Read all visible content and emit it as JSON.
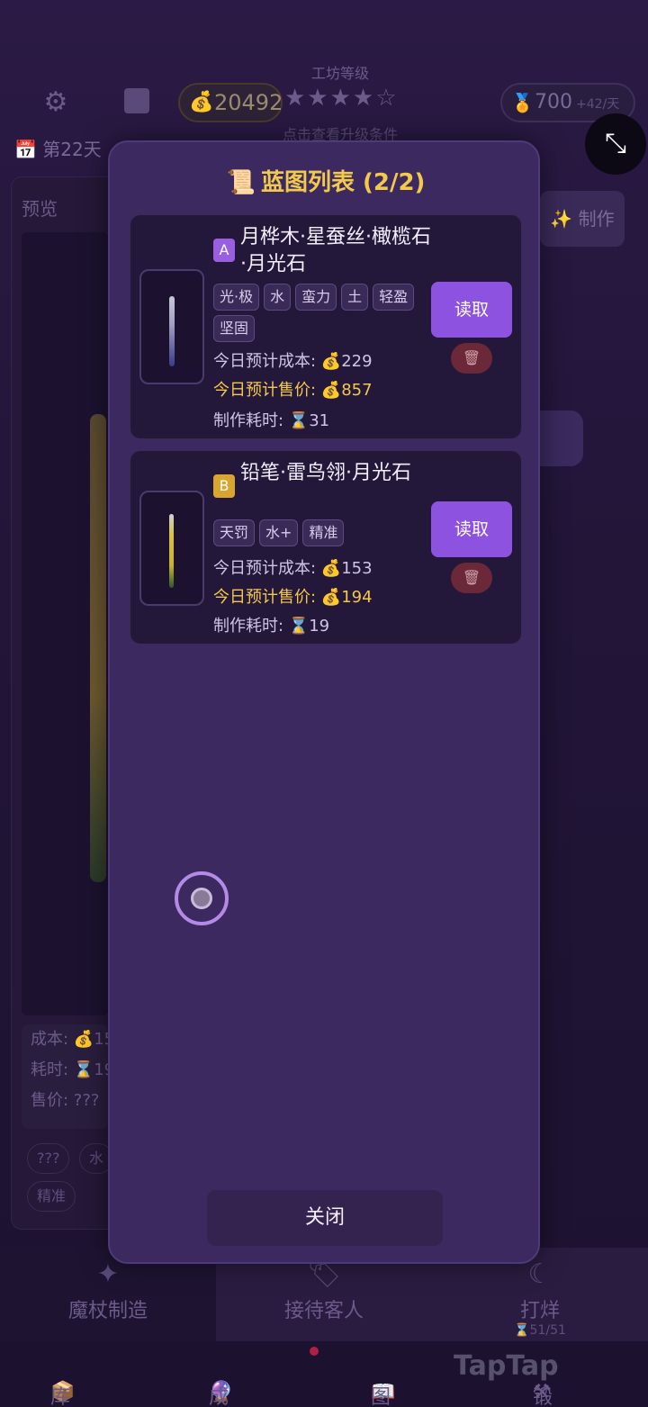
{
  "header": {
    "coins": "20492",
    "workshop_level_label": "工坊等级",
    "stars": "★★★★☆",
    "upgrade_hint": "点击查看升级条件",
    "medals": "700",
    "medal_rate": "+42/天",
    "day": "第22天"
  },
  "background": {
    "preview_label": "预览",
    "craft_label": "✨ 制作",
    "stats": [
      "成本: 💰15",
      "耗时: ⌛19",
      "售价: ???"
    ],
    "tags": [
      "???",
      "水",
      "精准"
    ]
  },
  "modal": {
    "title": "蓝图列表 (2/2)",
    "blueprints": [
      {
        "grade": "A",
        "name": "月桦木·星蚕丝·橄榄石·月光石",
        "tags": [
          "光·极",
          "水",
          "蛮力",
          "土",
          "轻盈",
          "坚固"
        ],
        "cost_label": "今日预计成本: 💰229",
        "price_label": "今日预计售价: 💰857",
        "time_label": "制作耗时: ⌛31",
        "read_label": "读取"
      },
      {
        "grade": "B",
        "name": "铅笔·雷鸟翎·月光石",
        "tags": [
          "天罚",
          "水+",
          "精准"
        ],
        "cost_label": "今日预计成本: 💰153",
        "price_label": "今日预计售价: 💰194",
        "time_label": "制作耗时: ⌛19",
        "read_label": "读取"
      }
    ],
    "close_label": "关闭"
  },
  "nav": {
    "tabs": [
      {
        "label": "魔杖制造",
        "icon": "wand-icon"
      },
      {
        "label": "接待客人",
        "icon": "tag-icon"
      },
      {
        "label": "打烊",
        "icon": "moon-icon",
        "sub": "⌛51/51"
      }
    ],
    "bottom": [
      "库存",
      "成就",
      "图鉴",
      "锻造"
    ]
  },
  "watermark": "TapTap",
  "colors": {
    "modal_bg": "#3b2960",
    "accent_purple": "#8e52e0",
    "gold": "#f2c94c",
    "grade_a": "#9a5ee0",
    "grade_b": "#d9a52e"
  }
}
